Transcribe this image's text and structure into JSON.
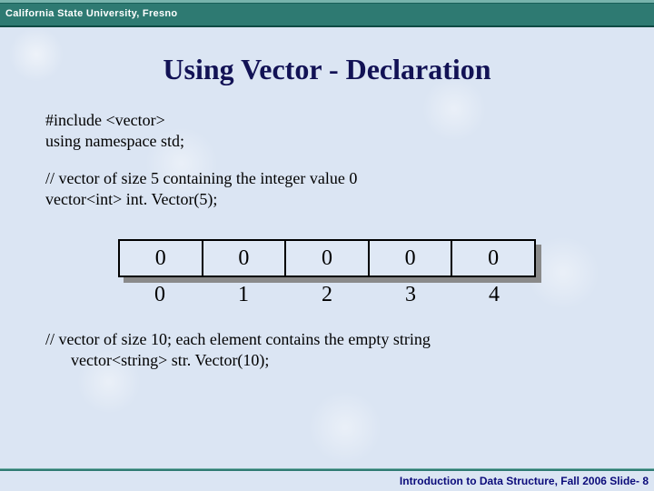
{
  "header": {
    "institution": "California State University, Fresno"
  },
  "slide": {
    "title": "Using Vector - Declaration",
    "code_block1_line1": "#include <vector>",
    "code_block1_line2": "using namespace std;",
    "code_block2_line1": "// vector of size 5 containing the integer value 0",
    "code_block2_line2": "vector<int> int. Vector(5);",
    "code_block3_line1": "// vector of size 10; each element contains the empty string",
    "code_block3_line2": "vector<string> str. Vector(10);"
  },
  "vector": {
    "values": [
      "0",
      "0",
      "0",
      "0",
      "0"
    ],
    "indices": [
      "0",
      "1",
      "2",
      "3",
      "4"
    ]
  },
  "footer": {
    "course": "Introduction to Data Structure, Fall 2006",
    "page_label": "Slide-",
    "page_number": "8"
  }
}
